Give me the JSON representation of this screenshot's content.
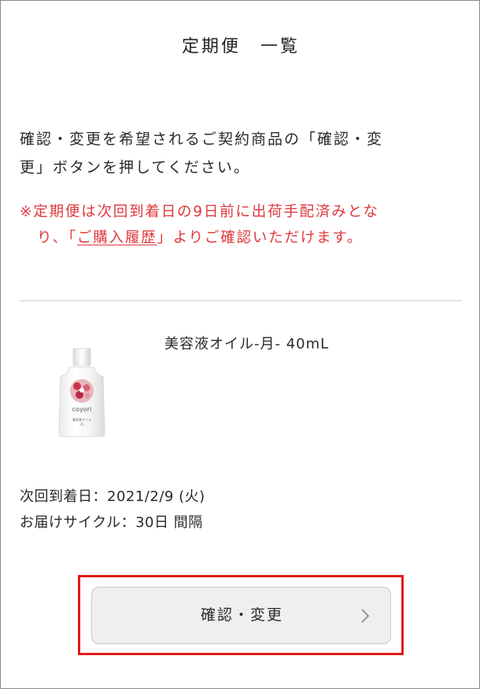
{
  "header": {
    "title": "定期便　一覧"
  },
  "intro": {
    "line1": "確認・変更を希望されるご契約商品の「確認・変",
    "line2": "更」ボタンを押してください。"
  },
  "notice": {
    "line1": "※定期便は次回到着日の9日前に出荷手配済みとな",
    "line2_prefix": "り、「",
    "link_label": "ご購入履歴",
    "line2_suffix": "」よりご確認いただけます。"
  },
  "product": {
    "name": "美容液オイル-月- 40mL",
    "bottle_brand": "coyori",
    "bottle_label": "美容液オイル",
    "bottle_sub": "-月-",
    "icon": "product-bottle-icon"
  },
  "delivery": {
    "next_arrival": "次回到着日：2021/2/9 (火)",
    "cycle": "お届けサイクル：30日 間隔"
  },
  "actions": {
    "confirm_label": "確認・変更",
    "chevron_icon": "chevron-right-icon"
  },
  "colors": {
    "notice": "#e0383e",
    "highlight": "#e21b1b",
    "button_bg": "#efefef"
  }
}
